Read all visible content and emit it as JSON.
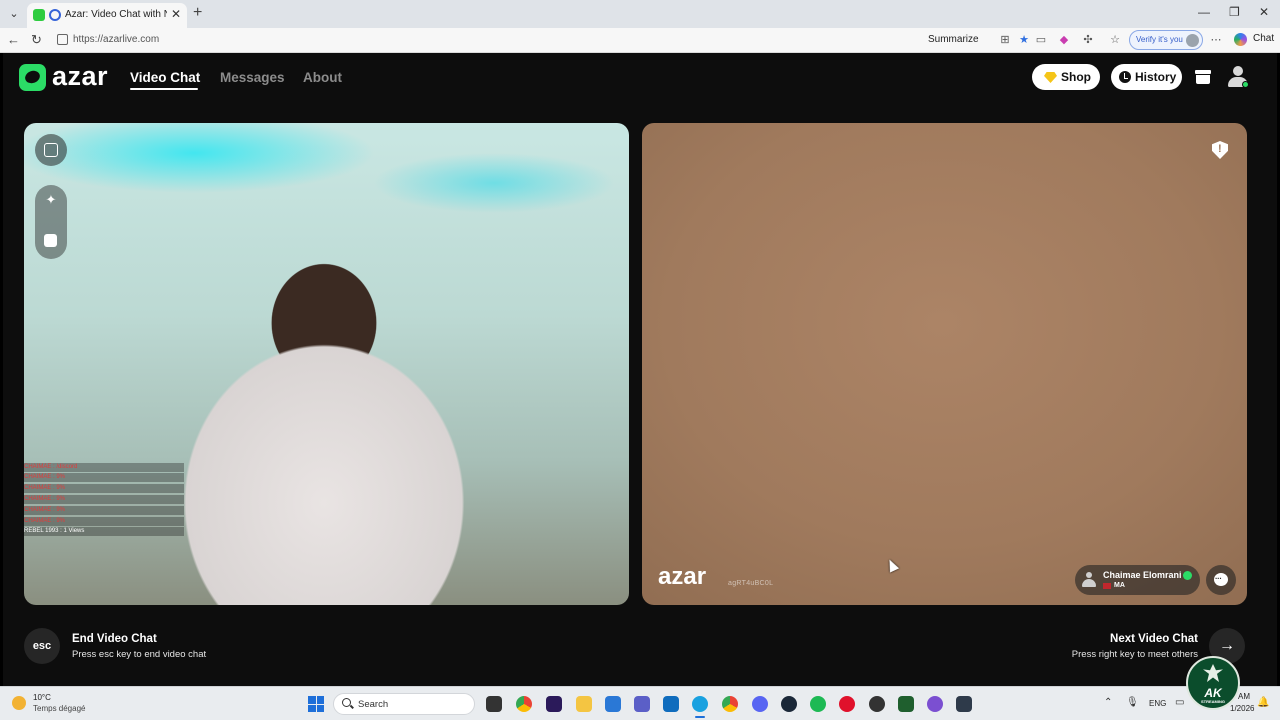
{
  "browser": {
    "tab_title": "Azar: Video Chat with New People",
    "url": "https://azarlive.com",
    "summarize_label": "Summarize",
    "verify_label": "Verify it's you",
    "chat_label": "Chat"
  },
  "site": {
    "logo_text": "azar",
    "nav": [
      "Video Chat",
      "Messages",
      "About"
    ],
    "shop_label": "Shop",
    "history_label": "History"
  },
  "self_video": {
    "overlay_lines": [
      "CHAIMAE : /discord",
      "CHAIMAE : 9%",
      "CHAIMAE : 9%",
      "CHAIMAE : 9%",
      "CHAIMAE : 9%",
      "CHAIMAE : 9%",
      "REBEL 1993 : 1 Views"
    ]
  },
  "remote_video": {
    "logo_text": "azar",
    "session_id": "agRT4uBC0L",
    "peer_name": "Chaimae Elomrani",
    "peer_country": "MA",
    "flag_color": "#c1272d"
  },
  "footer": {
    "esc_key": "esc",
    "end_title": "End Video Chat",
    "end_sub": "Press esc key to end video chat",
    "next_title": "Next Video Chat",
    "next_sub": "Press right key to meet others"
  },
  "taskbar": {
    "temperature": "10°C",
    "weather": "Temps dégagé",
    "search_label": "Search",
    "lang": "ENG",
    "time": "AM",
    "date": "1/2026"
  },
  "watermark": {
    "main": "AK",
    "sub": "STREAMING"
  },
  "colors": {
    "accent": "#2bdc66",
    "page_bg": "#0d0d0d",
    "remote_bg": "#a07a5d"
  }
}
